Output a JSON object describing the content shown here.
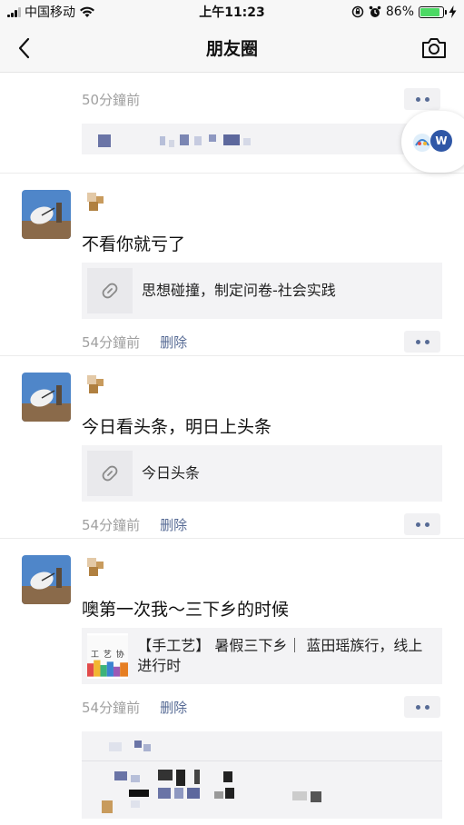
{
  "status_bar": {
    "carrier": "中国移动",
    "time": "上午11:23",
    "battery_percent": "86%",
    "battery_level": 0.86,
    "battery_color": "#4cd964"
  },
  "nav": {
    "title": "朋友圈",
    "back_icon": "chevron-left-icon",
    "camera_icon": "camera-icon"
  },
  "floating_bubble": {
    "badge": "W"
  },
  "posts": [
    {
      "time": "50分鐘前"
    },
    {
      "text": "不看你就亏了",
      "link_title": "思想碰撞，制定问卷-社会实践",
      "time": "54分鐘前",
      "delete_label": "删除"
    },
    {
      "text": "今日看头条，明日上头条",
      "link_title": "今日头条",
      "time": "54分鐘前",
      "delete_label": "删除"
    },
    {
      "text": "噢第一次我～三下乡的时候",
      "link_title": "【手工艺】 暑假三下乡｜ 蓝田瑶族行，线上进行时",
      "thumb_text": "工 艺 协",
      "time": "54分鐘前",
      "delete_label": "删除"
    }
  ],
  "colors": {
    "link_blue": "#576b95",
    "meta_gray": "#a0a0a0",
    "card_bg": "#f3f3f5"
  }
}
